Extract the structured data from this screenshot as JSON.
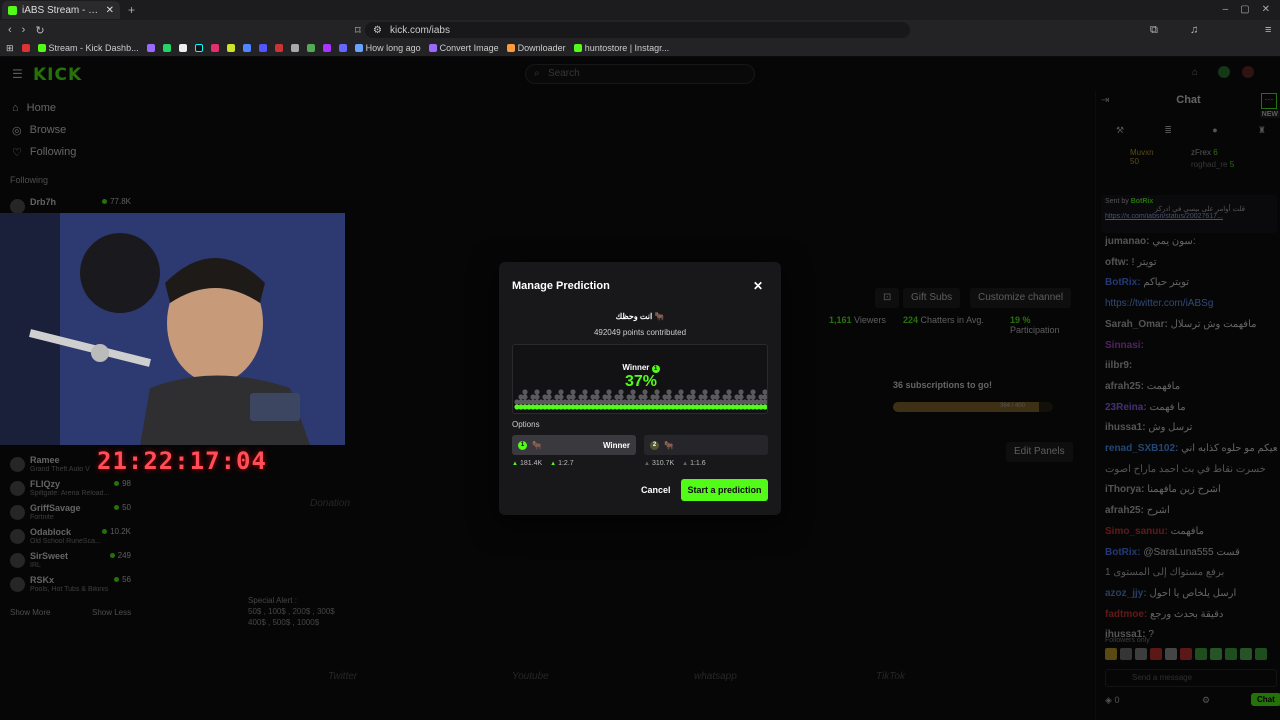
{
  "browser": {
    "tab_title": "iABS Stream - Watch Live on Kick",
    "new_tab": "+",
    "url": "kick.com/iabs",
    "bookmarks": [
      {
        "label": "Stream - Kick Dashb...",
        "color": "#53fc18"
      },
      {
        "label": "How long ago",
        "color": "#6aa3ff"
      },
      {
        "label": "Convert Image",
        "color": "#9a6aff"
      },
      {
        "label": "Downloader",
        "color": "#ff9a3a"
      },
      {
        "label": "huntostore | Instagr...",
        "color": "#53fc18"
      }
    ]
  },
  "site": {
    "logo": "KICK",
    "search_placeholder": "Search",
    "nav": [
      {
        "label": "Home",
        "icon": "home-icon"
      },
      {
        "label": "Browse",
        "icon": "compass-icon"
      },
      {
        "label": "Following",
        "icon": "heart-icon"
      }
    ],
    "following_header": "Following",
    "following": [
      {
        "name": "Drb7h",
        "viewers": "77.8K",
        "game": ""
      },
      {
        "name": "Ramee",
        "viewers": "",
        "game": "Grand Theft Auto V"
      },
      {
        "name": "FLIQzy",
        "viewers": "98",
        "game": "Spiltgate: Arena Reload..."
      },
      {
        "name": "GriffSavage",
        "viewers": "50",
        "game": "Fortnite"
      },
      {
        "name": "Odablock",
        "viewers": "10.2K",
        "game": "Old School RuneSca..."
      },
      {
        "name": "SirSweet",
        "viewers": "249",
        "game": "IRL"
      },
      {
        "name": "RSKx",
        "viewers": "56",
        "game": "Pools, Hot Tubs & Bikinis"
      }
    ],
    "show_more": "Show More",
    "show_less": "Show Less",
    "timer": "21:22:17:04",
    "gift_subs": "Gift Subs",
    "customize_channel": "Customize channel",
    "stats": {
      "viewers": "1,161",
      "viewers_label": "Viewers",
      "chatters": "224",
      "chatters_label": "Chatters in Avg.",
      "participation": "19 %",
      "participation_label": "Participation"
    },
    "subs_goal": "36 subscriptions to go!",
    "subs_progress": "364 / 400",
    "subs_fraction": 0.91,
    "edit_panels": "Edit Panels",
    "special_alert": "Special Alert :",
    "special_alert_line1": "50$ , 100$ , 200$ , 300$",
    "special_alert_line2": "400$ , 500$ , 1000$",
    "panel_labels": [
      "Donation",
      "Twitter",
      "Youtube",
      "whatsapp",
      "TikTok"
    ]
  },
  "chat": {
    "header": "Chat",
    "new_badge": "NEW",
    "top_users": [
      {
        "name": "Muvxn",
        "pts": "50"
      },
      {
        "name": "zFrex",
        "pts": "6"
      },
      {
        "name": "roghad_re",
        "pts": "5"
      }
    ],
    "pinned_sender": "Sent by",
    "pinned_bot": "BotRix",
    "pinned_text": "قلت أوامر على بيسي في ادركز",
    "pinned_link": "https://x.com/iabsn/status/20027617...",
    "messages": [
      {
        "user": "jumanao:",
        "text": "سون يمي:",
        "color": "#bbbbbb"
      },
      {
        "user": "oftw:",
        "text": "! تويتر",
        "color": "#bbbbbb"
      },
      {
        "user": "BotRix:",
        "text": "تويتر حياكم",
        "color": "#4f7cff"
      },
      {
        "user": "",
        "text": "https://twitter.com/iABSg",
        "color": "#6aa3ff"
      },
      {
        "user": "Sarah_Omar:",
        "text": "مافهمت وش ترسلال",
        "color": "#bbbbbb"
      },
      {
        "user": "Sinnasi:",
        "text": "",
        "color": "#b54bd8"
      },
      {
        "user": "iilbr9:",
        "text": "",
        "color": "#bbbbbb"
      },
      {
        "user": "afrah25:",
        "text": "مافهمت",
        "color": "#bbbbbb"
      },
      {
        "user": "23Reina:",
        "text": "ما فهمت",
        "color": "#9a6aff"
      },
      {
        "user": "ihussa1:",
        "text": "ترسل وش",
        "color": "#bbbbbb"
      },
      {
        "user": "renad_SXB102:",
        "text": "لعيكم مو حلوه كذابه اني",
        "color": "#4f9cff"
      },
      {
        "user": "",
        "text": "خسرت نقاط في بث احمد ماراح اصوت",
        "color": "#bbbbbb"
      },
      {
        "user": "iThorya:",
        "text": "اشرح زين مافهمنا",
        "color": "#bbbbbb"
      },
      {
        "user": "afrah25:",
        "text": "اشرح",
        "color": "#bbbbbb"
      },
      {
        "user": "Simo_sanuu:",
        "text": "مافهمت",
        "color": "#d13b3b"
      },
      {
        "user": "BotRix:",
        "text": "@SaraLuna555 قست",
        "color": "#4f7cff"
      },
      {
        "user": "",
        "text": "برفع مستواك إلى المستوى 1",
        "color": "#bbbbbb"
      },
      {
        "user": "azoz_jjy:",
        "text": "ارسل يلخاص يا احول",
        "color": "#5e86d6"
      },
      {
        "user": "fadtmoe:",
        "text": "دقيقة بحدث ورجع",
        "color": "#d13b3b"
      },
      {
        "user": "ihussa1:",
        "text": "?",
        "color": "#bbbbbb"
      }
    ],
    "followers_only": "Followers only",
    "input_placeholder": "Send a message",
    "points": "0",
    "chat_button": "Chat"
  },
  "modal": {
    "title": "Manage Prediction",
    "question": "انت وحظك 🐂",
    "points_contributed": "492049 points contributed",
    "winner_label": "Winner",
    "winner_pct": "37%",
    "options_label": "Options",
    "option_a": {
      "badge": "1",
      "icon": "🐂",
      "tag": "Winner",
      "points": "181.4K",
      "ratio": "1:2.7"
    },
    "option_b": {
      "badge": "2",
      "icon": "🐂",
      "tag": "",
      "points": "310.7K",
      "ratio": "1:1.6"
    },
    "cancel": "Cancel",
    "start": "Start a prediction"
  },
  "colors": {
    "accent": "#53fc18",
    "modal_bg": "#18181b",
    "timer": "#ff4d5a"
  }
}
